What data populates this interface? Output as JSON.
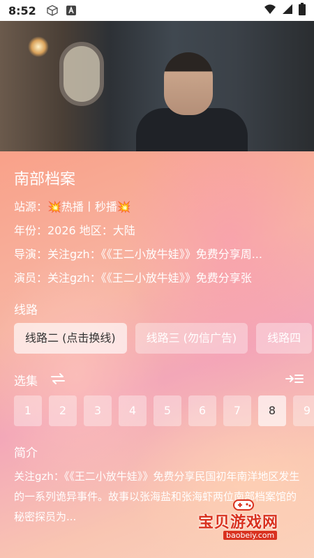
{
  "status_bar": {
    "time": "8:52",
    "icons": [
      "cube-icon",
      "a-badge-icon",
      "wifi-icon",
      "signal-icon",
      "battery-icon"
    ]
  },
  "video": {
    "description_icon": "video-frame"
  },
  "detail": {
    "title": "南部档案",
    "source": "站源：💥热播丨秒播💥",
    "year_region": "年份：2026  地区：大陆",
    "director": "导演：关注gzh：《《王二小放牛娃》》免费分享周...",
    "actors": "演员：关注gzh：《《王二小放牛娃》》免费分享张"
  },
  "lines": {
    "heading": "线路",
    "items": [
      {
        "label": "线路二 (点击换线)",
        "active": true
      },
      {
        "label": "线路三 (勿信广告)",
        "active": false
      },
      {
        "label": "线路四",
        "active": false
      }
    ]
  },
  "episodes": {
    "heading": "选集",
    "items": [
      "1",
      "2",
      "3",
      "4",
      "5",
      "6",
      "7",
      "8",
      "9"
    ],
    "active_index": 7
  },
  "intro": {
    "heading": "简介",
    "text": "关注gzh：《《王二小放牛娃》》免费分享民国初年南洋地区发生的一系列诡异事件。故事以张海盐和张海虾两位南部档案馆的秘密探员为..."
  },
  "watermark": {
    "title": "宝贝游戏网",
    "url": "baobeiy.com"
  },
  "colors": {
    "accent_red": "#d9321f",
    "text": "#ffffff"
  }
}
